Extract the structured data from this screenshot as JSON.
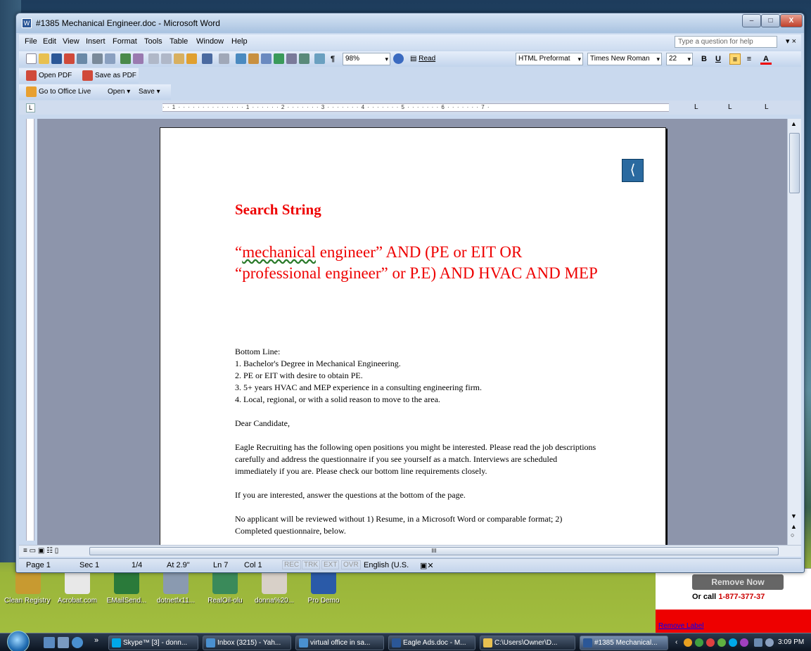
{
  "desktop": {
    "icons": [
      {
        "label": "Clean Registry f...",
        "color": "#c89a30"
      },
      {
        "label": "Acrobat.com",
        "color": "#e8e8e8"
      },
      {
        "label": "EMailSend...",
        "color": "#2a7a3a"
      },
      {
        "label": "dotnetfx11...",
        "color": "#8a9ab0"
      },
      {
        "label": "RealOil-olu",
        "color": "#3a8a5a"
      },
      {
        "label": "donna%20...",
        "color": "#d8d0c8"
      },
      {
        "label": "Pro Demo",
        "color": "#2a5aa8"
      }
    ],
    "ad": {
      "remove": "Remove Now",
      "call_prefix": "Or call",
      "phone": "1-877-377-37",
      "remove_label": "Remove Label"
    }
  },
  "window": {
    "title": "#1385 Mechanical Engineer.doc - Microsoft Word",
    "controls": {
      "minimize": "–",
      "maximize": "□",
      "close": "X"
    }
  },
  "menu": {
    "items": [
      "File",
      "Edit",
      "View",
      "Insert",
      "Format",
      "Tools",
      "Table",
      "Window",
      "Help"
    ],
    "help_placeholder": "Type a question for help"
  },
  "toolbar": {
    "zoom": "98%",
    "read": "Read",
    "style": "HTML Preformat",
    "font": "Times New Roman",
    "size": "22",
    "bold": "B",
    "underline": "U",
    "font_color": "A"
  },
  "pdfbar": {
    "open_pdf": "Open PDF",
    "save_as_pdf": "Save as PDF"
  },
  "officebar": {
    "go_live": "Go to Office Live",
    "open": "Open ▾",
    "save": "Save ▾"
  },
  "ruler": {
    "marks": "· · 1 · · · · · · · · · · · · · · 1 · · · · · · 2 · · · · · · · 3 · · · · · · · 4 · · · · · · · 5 · · · · · · · 6 · · · · · · · 7 ·"
  },
  "document": {
    "heading": "Search String",
    "search_open": "“",
    "search_word": "mechanical",
    "search_rest": " engineer” AND (PE or EIT OR “professional engineer” or P.E) AND HVAC AND MEP",
    "bottom_line": "Bottom Line:",
    "items": [
      "1.  Bachelor's Degree in Mechanical Engineering.",
      "2.  PE or EIT with desire to obtain PE.",
      "3.  5+ years HVAC and MEP experience in a consulting engineering firm.",
      "4.  Local, regional, or with a solid reason to move to the area."
    ],
    "greeting": "Dear Candidate,",
    "para1": "Eagle Recruiting has the following open positions you might be interested. Please read the job descriptions carefully and address the questionnaire if you see yourself as a match. Interviews are scheduled immediately if you are. Please check our bottom line requirements closely.",
    "para2": "If you are interested, answer the questions at the bottom of the page.",
    "para3": "No applicant will be reviewed without 1) Resume, in a Microsoft Word or comparable format; 2) Completed questionnaire, below."
  },
  "status": {
    "page": "Page 1",
    "sec": "Sec 1",
    "pages": "1/4",
    "at": "At 2.9\"",
    "ln": "Ln 7",
    "col": "Col 1",
    "rec": "REC",
    "trk": "TRK",
    "ext": "EXT",
    "ovr": "OVR",
    "lang": "English (U.S."
  },
  "taskbar": {
    "buttons": [
      {
        "label": "Skype™ [3] - donn...",
        "color": "#00a8e8"
      },
      {
        "label": "Inbox (3215) - Yah...",
        "color": "#4a90d0"
      },
      {
        "label": "virtual office in sa...",
        "color": "#4a90d0"
      },
      {
        "label": "Eagle Ads.doc - M...",
        "color": "#2b5797"
      },
      {
        "label": "C:\\Users\\Owner\\D...",
        "color": "#e8c050"
      },
      {
        "label": "#1385 Mechanical...",
        "color": "#2b5797"
      }
    ],
    "overflow": "»",
    "clock": "3:09 PM"
  }
}
